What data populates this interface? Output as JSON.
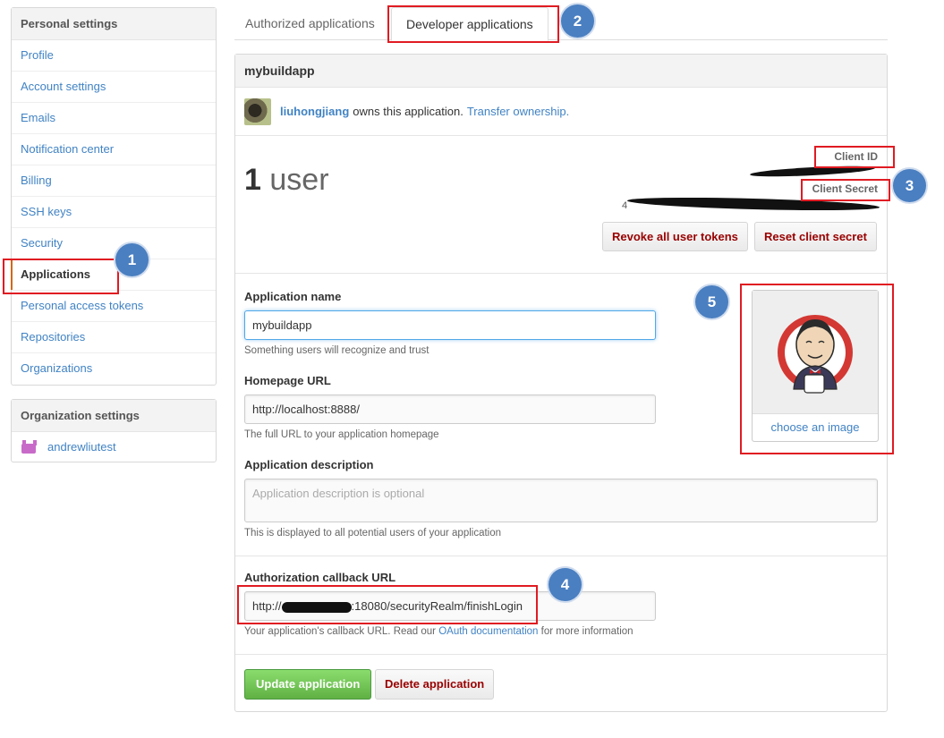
{
  "sidebar": {
    "personal_heading": "Personal settings",
    "items": [
      {
        "label": "Profile"
      },
      {
        "label": "Account settings"
      },
      {
        "label": "Emails"
      },
      {
        "label": "Notification center"
      },
      {
        "label": "Billing"
      },
      {
        "label": "SSH keys"
      },
      {
        "label": "Security"
      },
      {
        "label": "Applications"
      },
      {
        "label": "Personal access tokens"
      },
      {
        "label": "Repositories"
      },
      {
        "label": "Organizations"
      }
    ],
    "selected_item": "Applications",
    "org_heading": "Organization settings",
    "org_items": [
      {
        "label": "andrewliutest"
      }
    ]
  },
  "tabs": {
    "authorized": "Authorized applications",
    "developer": "Developer applications",
    "active": "Developer applications"
  },
  "app": {
    "name": "mybuildapp",
    "owner": "liuhongjiang",
    "owns_text": "owns this application.",
    "transfer_link": "Transfer ownership.",
    "user_count": "1",
    "user_word": "user",
    "client_id_label": "Client ID",
    "client_secret_label": "Client Secret",
    "secret_partial": "4",
    "revoke_label": "Revoke all user tokens",
    "reset_label": "Reset client secret"
  },
  "form": {
    "name_label": "Application name",
    "name_value": "mybuildapp",
    "name_note": "Something users will recognize and trust",
    "homepage_label": "Homepage URL",
    "homepage_value": "http://localhost:8888/",
    "homepage_note": "The full URL to your application homepage",
    "description_label": "Application description",
    "description_placeholder": "Application description is optional",
    "description_note": "This is displayed to all potential users of your application",
    "callback_label": "Authorization callback URL",
    "callback_prefix": "http://",
    "callback_suffix": ":18080/securityRealm/finishLogin",
    "callback_note_before": "Your application's callback URL. Read our",
    "callback_note_link": "OAuth documentation",
    "callback_note_after": "for more information",
    "choose_image": "choose an image",
    "update_label": "Update application",
    "delete_label": "Delete application"
  },
  "annotations": {
    "n1": "1",
    "n2": "2",
    "n3": "3",
    "n4": "4",
    "n5": "5"
  },
  "colors": {
    "link": "#4183c4",
    "danger": "#990000",
    "primary_green": "#60b044",
    "annotation_red": "#e01b22",
    "annotation_blue": "#4a7fc1"
  }
}
